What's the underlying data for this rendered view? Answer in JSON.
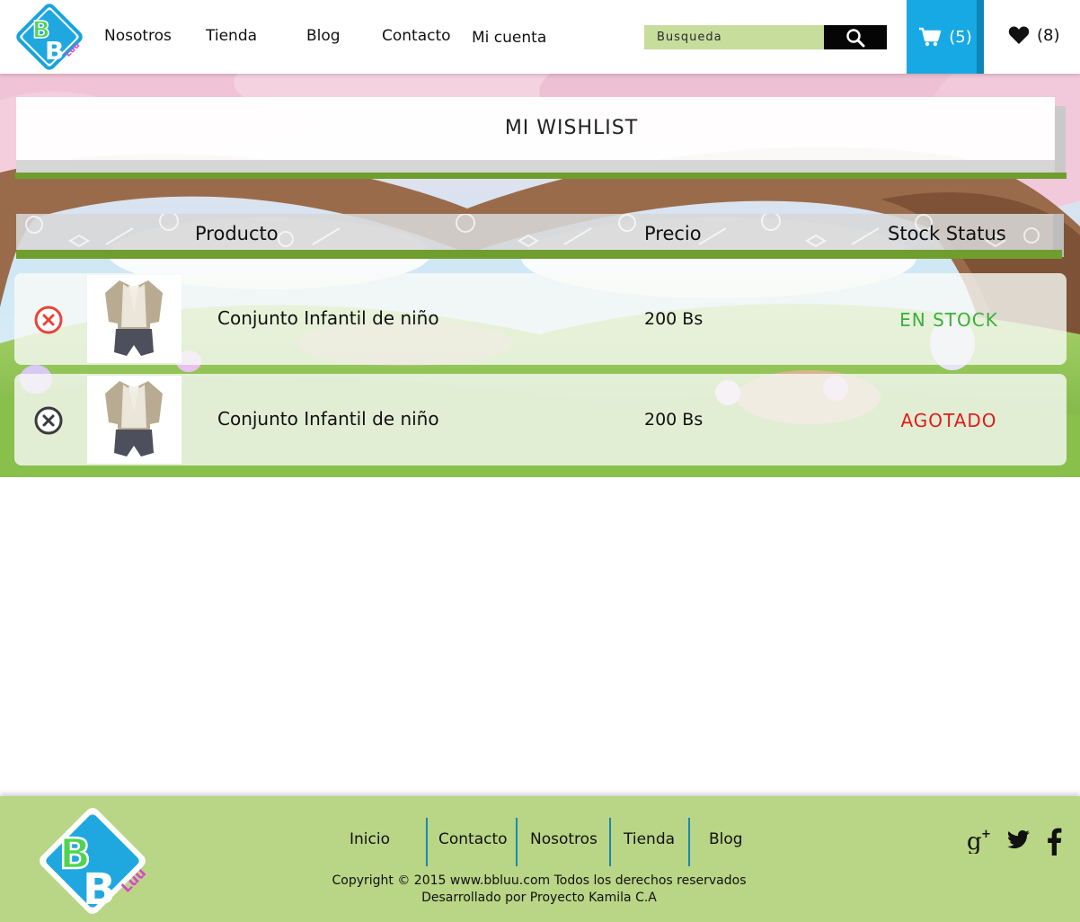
{
  "header": {
    "logo_text": "BB Luu",
    "nav": [
      {
        "label": "Nosotros"
      },
      {
        "label": "Tienda"
      },
      {
        "label": "Blog"
      },
      {
        "label": "Contacto"
      },
      {
        "label": "Mi cuenta"
      }
    ],
    "search": {
      "placeholder": "Busqueda",
      "icon": "search-icon"
    },
    "cart": {
      "count": "(5)",
      "icon": "cart-icon",
      "color": "#17a9e3"
    },
    "wishlist": {
      "count": "(8)",
      "icon": "heart-icon"
    }
  },
  "page": {
    "title": "MI WISHLIST",
    "columns": {
      "product": "Producto",
      "price": "Precio",
      "stock": "Stock Status"
    },
    "items": [
      {
        "name": "Conjunto Infantil de niño",
        "price": "200 Bs",
        "stock": "EN STOCK",
        "stock_color": "#39b03d",
        "remove_icon": "remove-circle-red-icon"
      },
      {
        "name": "Conjunto Infantil de niño",
        "price": "200 Bs",
        "stock": "AGOTADO",
        "stock_color": "#e11b1b",
        "remove_icon": "remove-circle-dark-icon"
      }
    ]
  },
  "footer": {
    "nav": [
      {
        "label": "Inicio"
      },
      {
        "label": "Contacto"
      },
      {
        "label": "Nosotros"
      },
      {
        "label": "Tienda"
      },
      {
        "label": "Blog"
      }
    ],
    "copyright_line1": "Copyright © 2015 www.bbluu.com Todos los derechos reservados",
    "copyright_line2": "Desarrollado por Proyecto Kamila C.A",
    "social": [
      "google-plus-icon",
      "twitter-icon",
      "facebook-icon"
    ],
    "background_color": "#b9d586"
  },
  "colors": {
    "accent_green": "#6f9e2e",
    "accent_blue": "#17a9e3",
    "search_bg": "#c6dd9c"
  }
}
